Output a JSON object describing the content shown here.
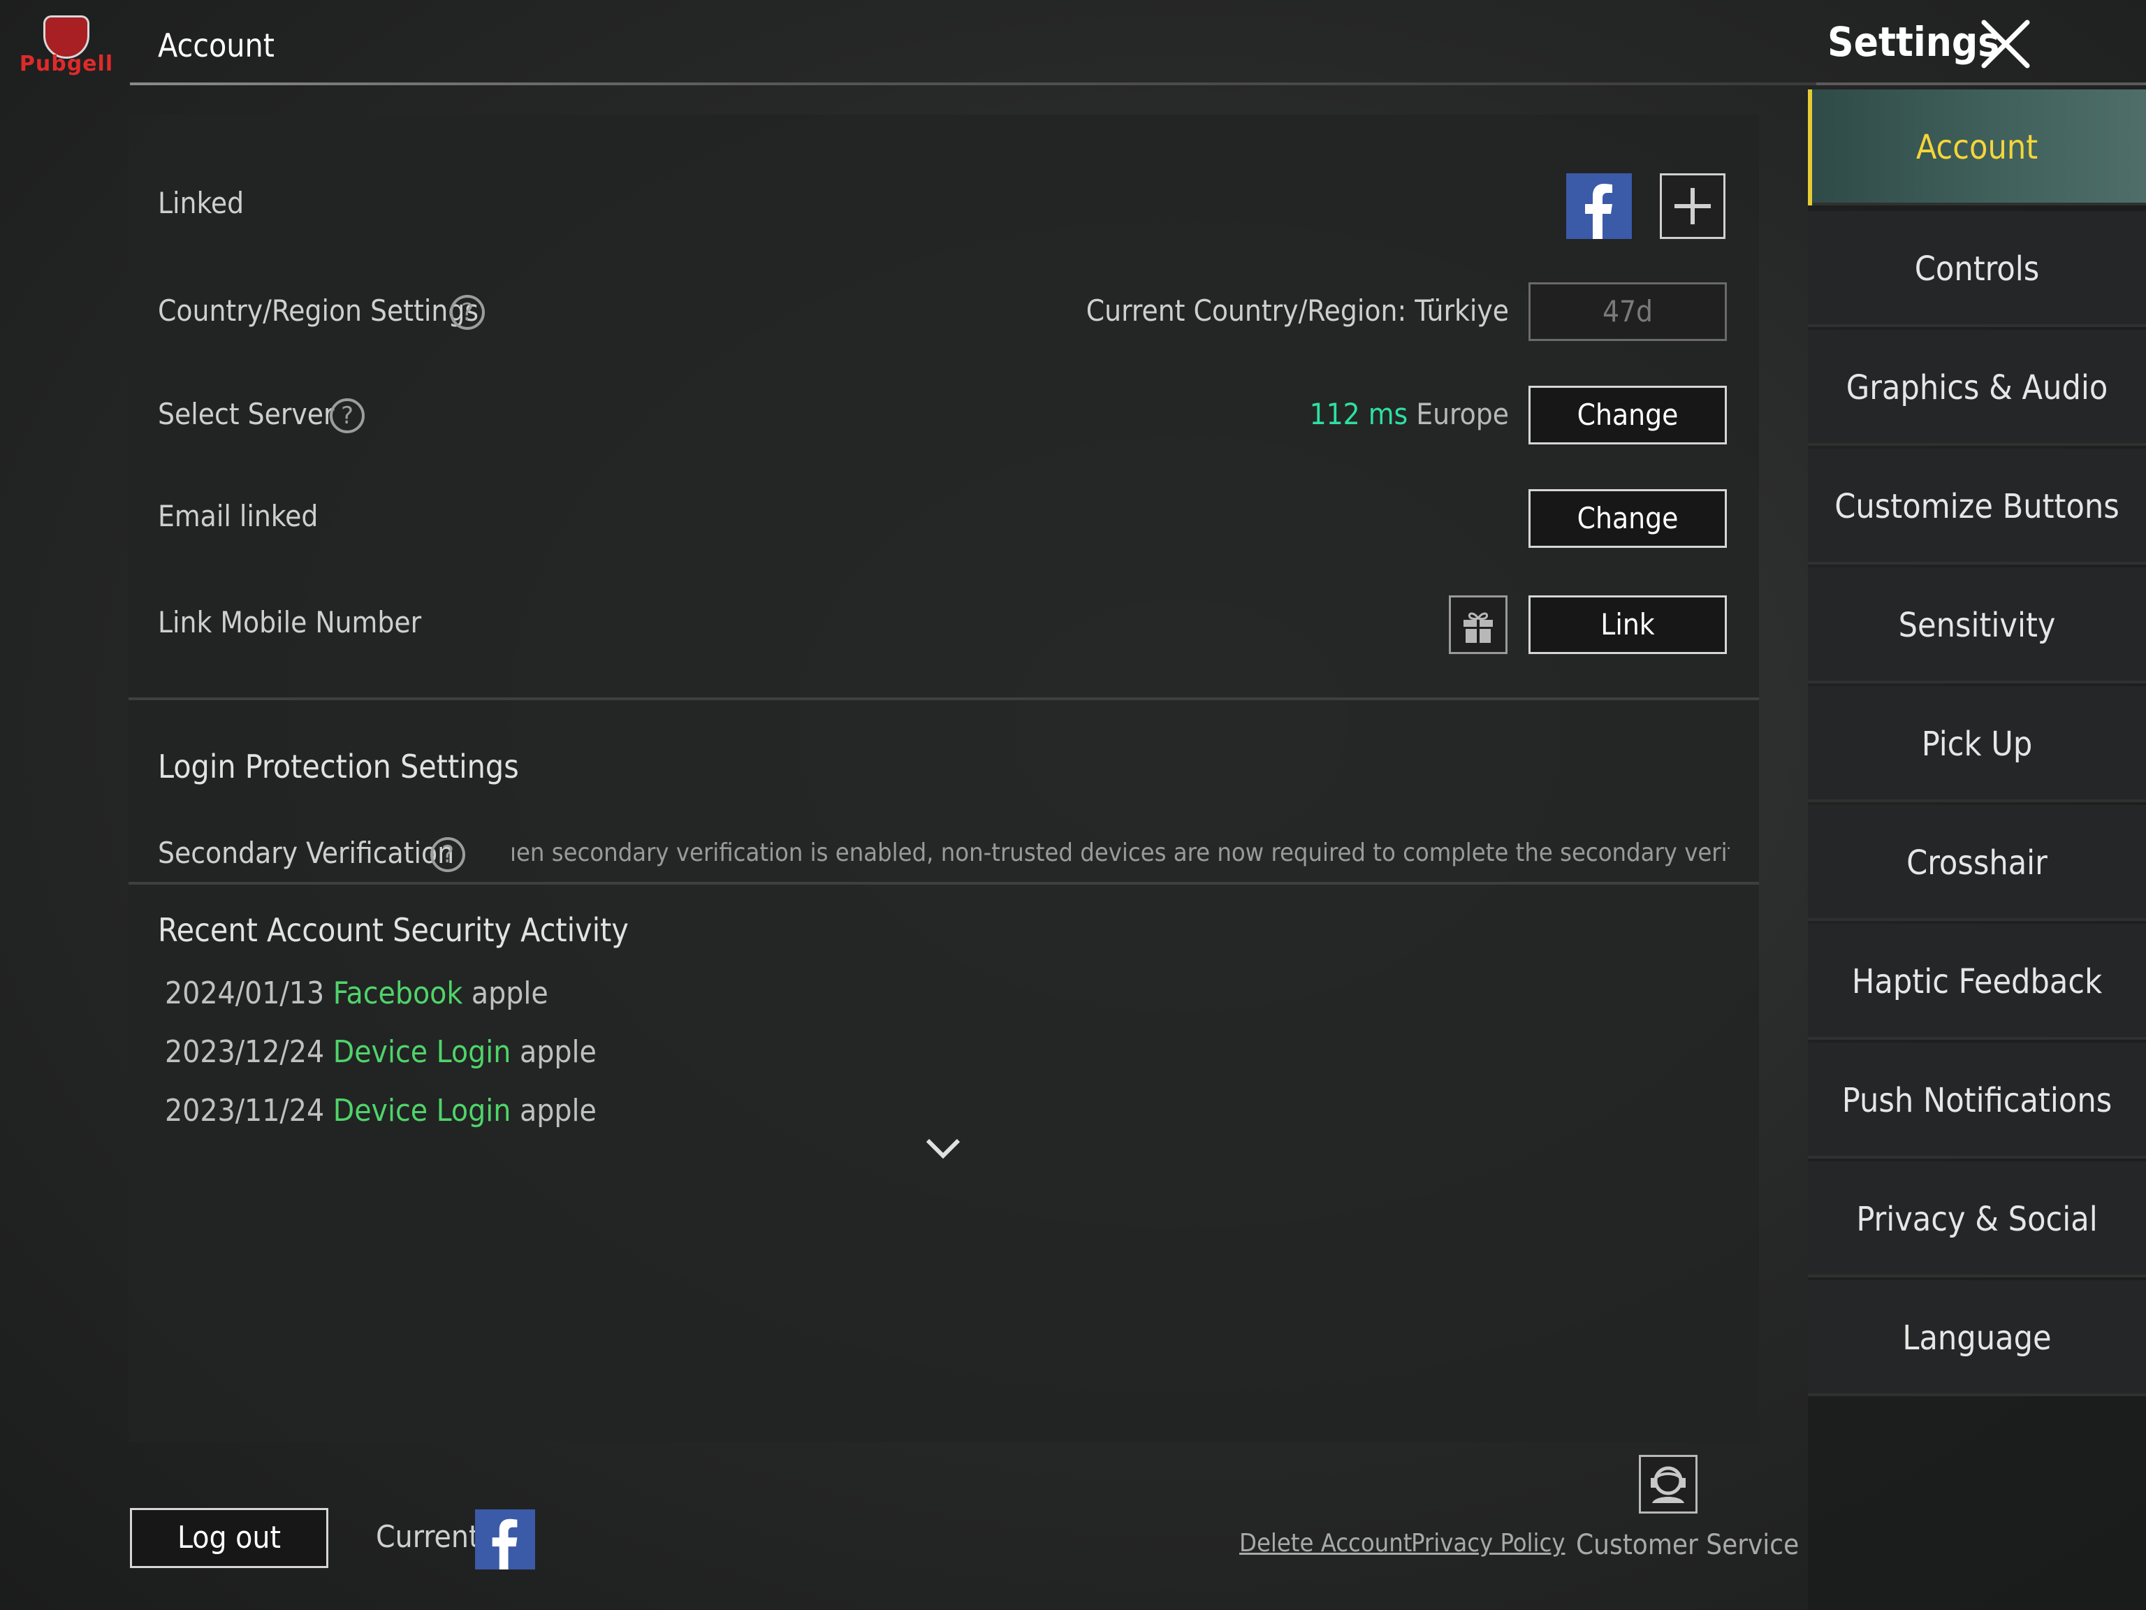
{
  "header": {
    "logo_text": "Pubgell",
    "title": "Account"
  },
  "settings": {
    "title": "Settings"
  },
  "account": {
    "linked_label": "Linked",
    "country": {
      "label": "Country/Region Settings",
      "current_text": "Current Country/Region: Türkiye",
      "cooldown": "47d"
    },
    "server": {
      "label": "Select Server",
      "ping": "112 ms",
      "region": "Europe",
      "button": "Change"
    },
    "email": {
      "label": "Email linked",
      "button": "Change"
    },
    "mobile": {
      "label": "Link Mobile Number",
      "button": "Link"
    },
    "login_protection": {
      "heading": "Login Protection Settings",
      "secondary_label": "Secondary Verification",
      "secondary_text": "ıen secondary verification is enabled, non-trusted devices are now required to complete the secondary verification to en"
    },
    "recent": {
      "heading": "Recent Account Security Activity",
      "items": [
        {
          "date": "2024/01/13",
          "event": "Facebook",
          "device": "apple"
        },
        {
          "date": "2023/12/24",
          "event": "Device Login",
          "device": "apple"
        },
        {
          "date": "2023/11/24",
          "event": "Device Login",
          "device": "apple"
        }
      ]
    }
  },
  "sidebar": {
    "items": [
      {
        "label": "Account",
        "active": true
      },
      {
        "label": "Controls"
      },
      {
        "label": "Graphics & Audio"
      },
      {
        "label": "Customize Buttons"
      },
      {
        "label": "Sensitivity"
      },
      {
        "label": "Pick Up"
      },
      {
        "label": "Crosshair"
      },
      {
        "label": "Haptic Feedback"
      },
      {
        "label": "Push Notifications"
      },
      {
        "label": "Privacy & Social"
      },
      {
        "label": "Language"
      }
    ]
  },
  "footer": {
    "logout": "Log out",
    "current_label": "Current",
    "delete_account": "Delete Account",
    "privacy_policy": "Privacy Policy",
    "customer_service": "Customer Service"
  },
  "colors": {
    "accent_yellow": "#f5d638",
    "ping_green": "#2ee0a0",
    "event_green": "#4fd46a",
    "facebook_blue": "#3b5aa8"
  },
  "icons": [
    "facebook-icon",
    "plus-icon",
    "help-icon",
    "gift-icon",
    "chevron-down-icon",
    "close-icon",
    "customer-service-icon"
  ]
}
